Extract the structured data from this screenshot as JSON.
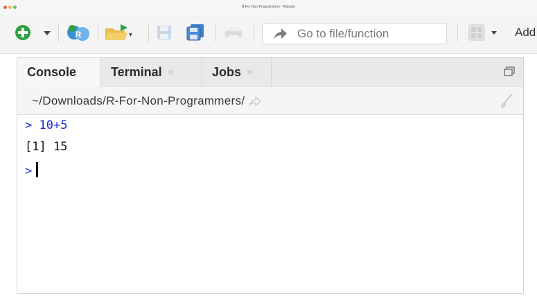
{
  "window": {
    "title": "R For Non Programmers - RStudio",
    "traffic_colors": [
      "#ee5f57",
      "#f5bd4f",
      "#5fc453"
    ]
  },
  "toolbar": {
    "goto_placeholder": "Go to file/function",
    "addins_label": "Add",
    "icons": [
      "new-file-icon",
      "dropdown-arrow-icon",
      "new-project-icon",
      "open-folder-icon",
      "save-icon",
      "save-all-icon",
      "print-icon",
      "goto-arrow-icon",
      "grid-layout-icon"
    ]
  },
  "pane": {
    "tabs": [
      {
        "label": "Console",
        "active": true,
        "closable": false
      },
      {
        "label": "Terminal",
        "active": false,
        "closable": true
      },
      {
        "label": "Jobs",
        "active": false,
        "closable": true
      }
    ],
    "close_glyph": "×",
    "path": "~/Downloads/R-For-Non-Programmers/"
  },
  "console": {
    "lines": [
      {
        "prompt": ">",
        "text": "10+5"
      },
      {
        "output": "[1] 15"
      },
      {
        "prompt": ">"
      }
    ]
  }
}
